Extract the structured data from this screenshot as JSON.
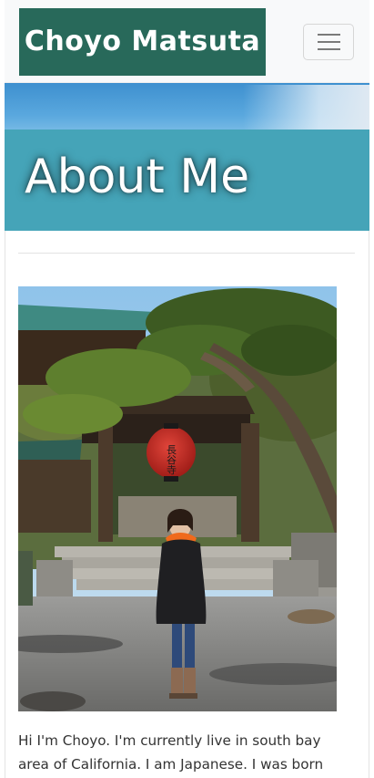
{
  "navbar": {
    "brand": "Choyo Matsuta",
    "toggle_icon": "hamburger-menu-icon"
  },
  "hero": {
    "title": "About Me",
    "background_color": "#45a4b8"
  },
  "brand_color": "#28695a",
  "photo": {
    "lantern_text": "長谷寺"
  },
  "intro": {
    "text": "Hi I'm Choyo. I'm currently live in south bay area of California. I am Japanese. I was born"
  }
}
